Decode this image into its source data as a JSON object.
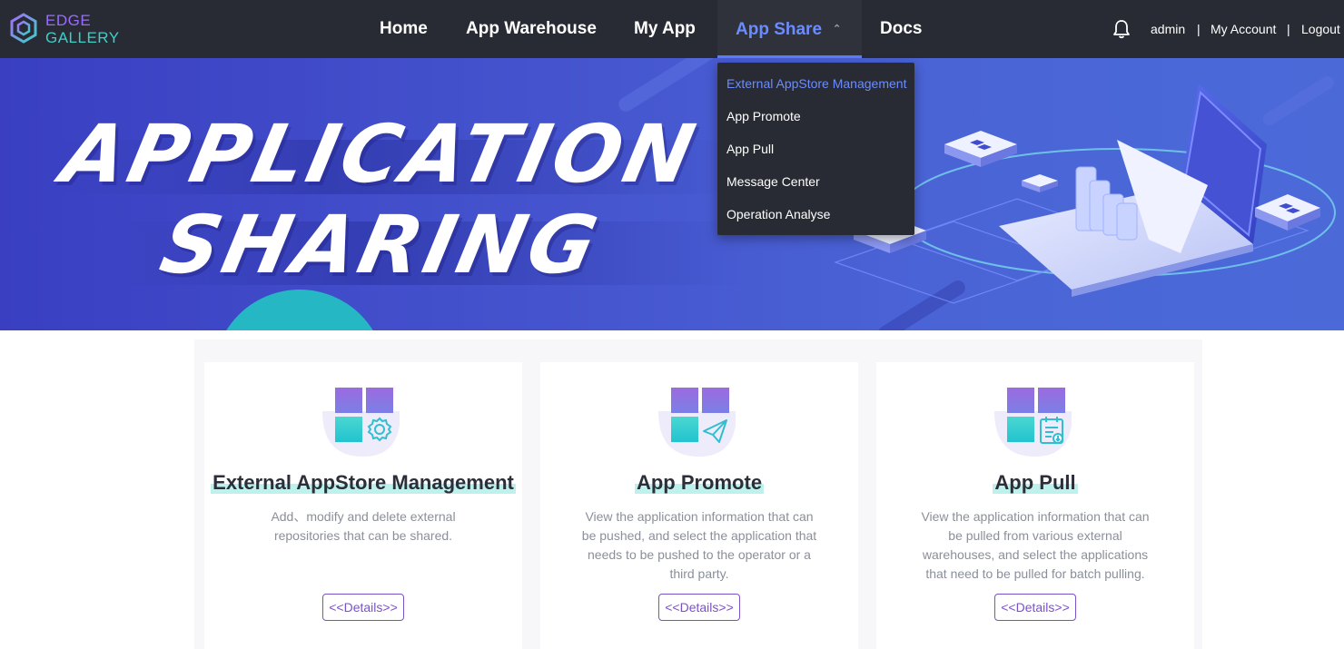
{
  "logo": {
    "line1": "EDGE",
    "line2": "GALLERY"
  },
  "nav": {
    "home": "Home",
    "app_warehouse": "App Warehouse",
    "my_app": "My App",
    "app_share": "App Share",
    "docs": "Docs"
  },
  "user": {
    "name": "admin",
    "separator": "|",
    "my_account": "My Account",
    "logout": "Logout"
  },
  "banner": {
    "line1": "APPLICATION",
    "line2": "SHARING"
  },
  "dropdown": {
    "items": [
      {
        "label": "External AppStore Management",
        "active": true
      },
      {
        "label": "App Promote"
      },
      {
        "label": "App Pull"
      },
      {
        "label": "Message Center"
      },
      {
        "label": "Operation Analyse"
      }
    ]
  },
  "cards": [
    {
      "title": "External AppStore Management",
      "description": "Add、modify and delete external repositories that can be shared.",
      "button": "<<Details>>",
      "icon": "gear-icon"
    },
    {
      "title": "App Promote",
      "description": "View the application information that can be pushed, and select the application that needs to be pushed to the operator or a third party.",
      "button": "<<Details>>",
      "icon": "paper-plane-icon"
    },
    {
      "title": "App Pull",
      "description": "View the application information that can be pulled from various external warehouses, and select the applications that need to be pulled for batch pulling.",
      "button": "<<Details>>",
      "icon": "document-download-icon"
    }
  ],
  "colors": {
    "nav_bg": "#282b33",
    "accent": "#6b8cff",
    "brand_purple": "#9a6cff",
    "brand_teal": "#3dd0c8",
    "button_border": "#7a52c8",
    "title_highlight": "#bdf1ec"
  }
}
